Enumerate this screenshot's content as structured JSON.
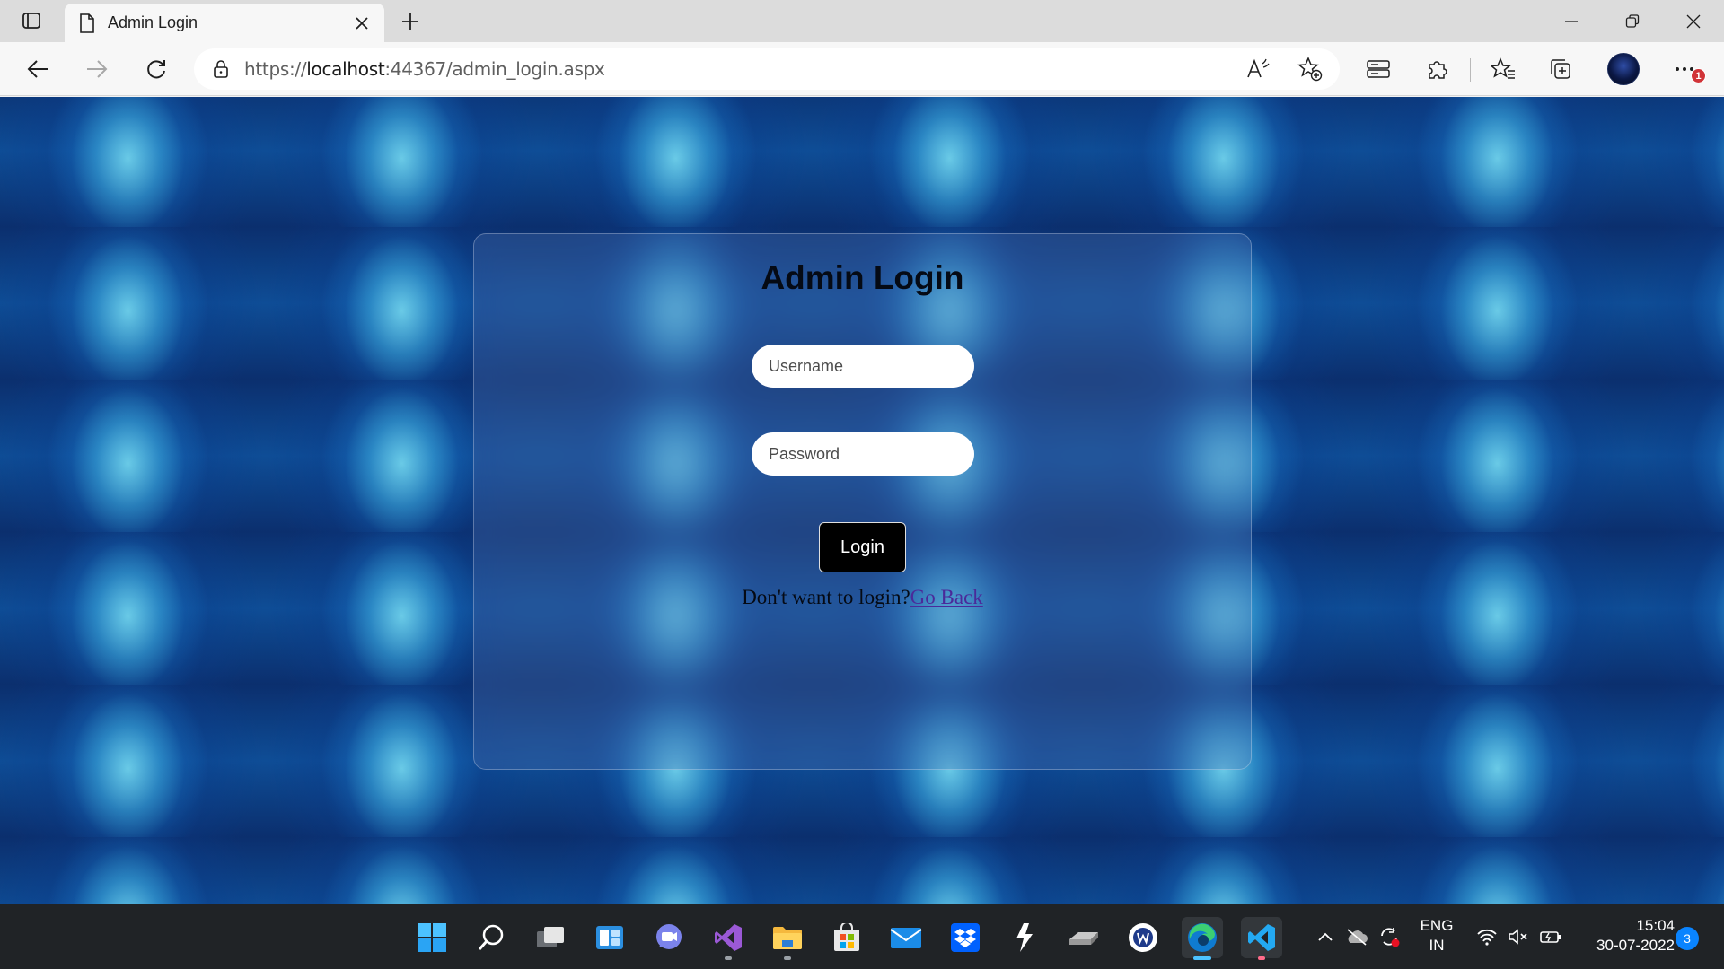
{
  "browser": {
    "tab": {
      "title": "Admin Login",
      "close_icon": "close-icon"
    },
    "new_tab_icon": "plus-icon",
    "address": {
      "scheme": "https://",
      "host": "localhost",
      "rest": ":44367/admin_login.aspx"
    }
  },
  "page": {
    "title": "Admin Login",
    "username_placeholder": "Username",
    "password_placeholder": "Password",
    "login_label": "Login",
    "back_text": "Don't want to login?",
    "back_link": "Go Back"
  },
  "notifications": {
    "profile_badge": "1"
  },
  "taskbar": {
    "language": {
      "line1": "ENG",
      "line2": "IN"
    },
    "clock": {
      "time": "15:04",
      "date": "30-07-2022"
    },
    "notification_count": "3"
  },
  "colors": {
    "card_tint": "#5a78b4",
    "button_bg": "#000000",
    "link": "#4a2a9a",
    "taskbar": "#202326"
  }
}
